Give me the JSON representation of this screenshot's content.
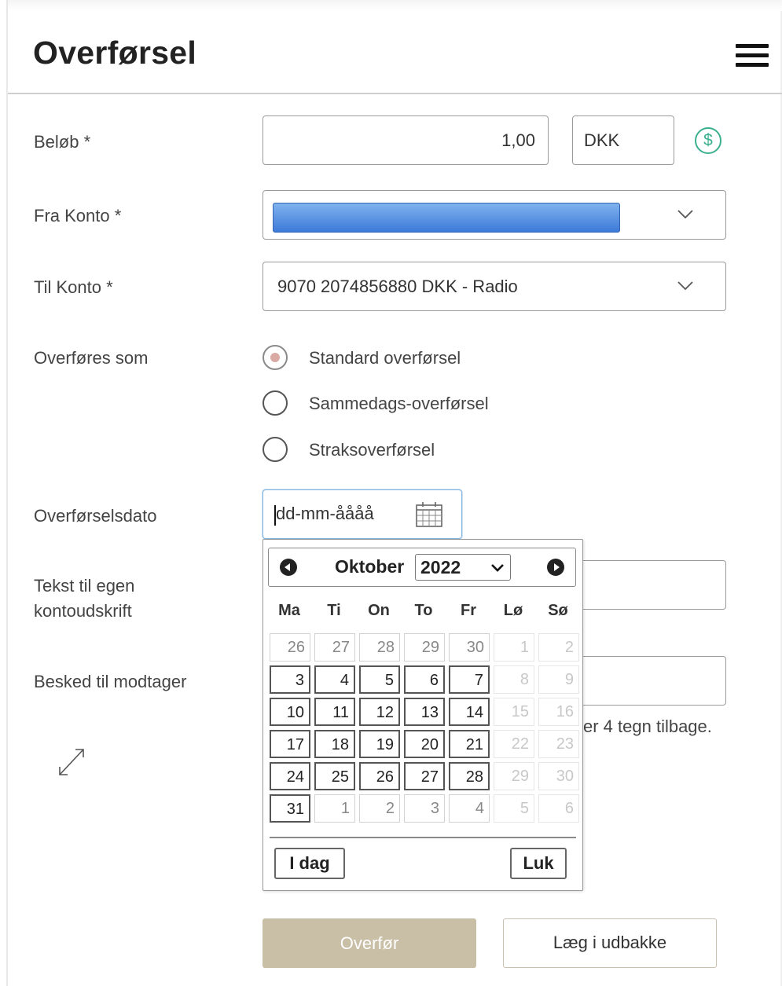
{
  "header": {
    "title": "Overførsel",
    "menu_icon": "hamburger-menu-icon"
  },
  "form": {
    "amount": {
      "label": "Beløb *",
      "value": "1,00",
      "currency": "DKK",
      "currency_icon": "dollar-circle-icon"
    },
    "from_account": {
      "label": "Fra Konto *",
      "value": ""
    },
    "to_account": {
      "label": "Til Konto *",
      "value": "9070 2074856880 DKK - Radio"
    },
    "transfer_type": {
      "label": "Overføres som",
      "options": [
        {
          "label": "Standard overførsel",
          "checked": true
        },
        {
          "label": "Sammedags-overførsel",
          "checked": false
        },
        {
          "label": "Straksoverførsel",
          "checked": false
        }
      ]
    },
    "date": {
      "label": "Overførselsdato",
      "placeholder": "dd-mm-åååå"
    },
    "own_text": {
      "label_line1": "Tekst til egen",
      "label_line2": "kontoudskrift"
    },
    "message": {
      "label": "Besked til modtager",
      "hint": "er 4 tegn tilbage."
    }
  },
  "calendar": {
    "month": "Oktober",
    "year": "2022",
    "weekdays": [
      "Ma",
      "Ti",
      "On",
      "To",
      "Fr",
      "Lø",
      "Sø"
    ],
    "weeks": [
      [
        [
          "26",
          "other"
        ],
        [
          "27",
          "other"
        ],
        [
          "28",
          "other"
        ],
        [
          "29",
          "other"
        ],
        [
          "30",
          "other"
        ],
        [
          "1",
          "weekend-other"
        ],
        [
          "2",
          "weekend-other"
        ]
      ],
      [
        [
          "3",
          "cur"
        ],
        [
          "4",
          "cur"
        ],
        [
          "5",
          "cur"
        ],
        [
          "6",
          "cur"
        ],
        [
          "7",
          "cur"
        ],
        [
          "8",
          "weekend-other"
        ],
        [
          "9",
          "weekend-other"
        ]
      ],
      [
        [
          "10",
          "cur"
        ],
        [
          "11",
          "cur"
        ],
        [
          "12",
          "cur"
        ],
        [
          "13",
          "cur"
        ],
        [
          "14",
          "cur"
        ],
        [
          "15",
          "weekend-other"
        ],
        [
          "16",
          "weekend-other"
        ]
      ],
      [
        [
          "17",
          "cur"
        ],
        [
          "18",
          "cur"
        ],
        [
          "19",
          "cur"
        ],
        [
          "20",
          "cur"
        ],
        [
          "21",
          "cur"
        ],
        [
          "22",
          "weekend-other"
        ],
        [
          "23",
          "weekend-other"
        ]
      ],
      [
        [
          "24",
          "cur"
        ],
        [
          "25",
          "cur"
        ],
        [
          "26",
          "cur"
        ],
        [
          "27",
          "cur"
        ],
        [
          "28",
          "cur"
        ],
        [
          "29",
          "weekend-other"
        ],
        [
          "30",
          "weekend-other"
        ]
      ],
      [
        [
          "31",
          "cur"
        ],
        [
          "1",
          "other"
        ],
        [
          "2",
          "other"
        ],
        [
          "3",
          "other"
        ],
        [
          "4",
          "other"
        ],
        [
          "5",
          "weekend-other"
        ],
        [
          "6",
          "weekend-other"
        ]
      ]
    ],
    "today_label": "I dag",
    "close_label": "Luk"
  },
  "actions": {
    "submit_label": "Overfør",
    "outbox_label": "Læg i udbakke"
  },
  "colors": {
    "accent_green": "#3bb08f",
    "submit_bg": "#c9bea6",
    "focus_blue": "#80b4e0"
  }
}
